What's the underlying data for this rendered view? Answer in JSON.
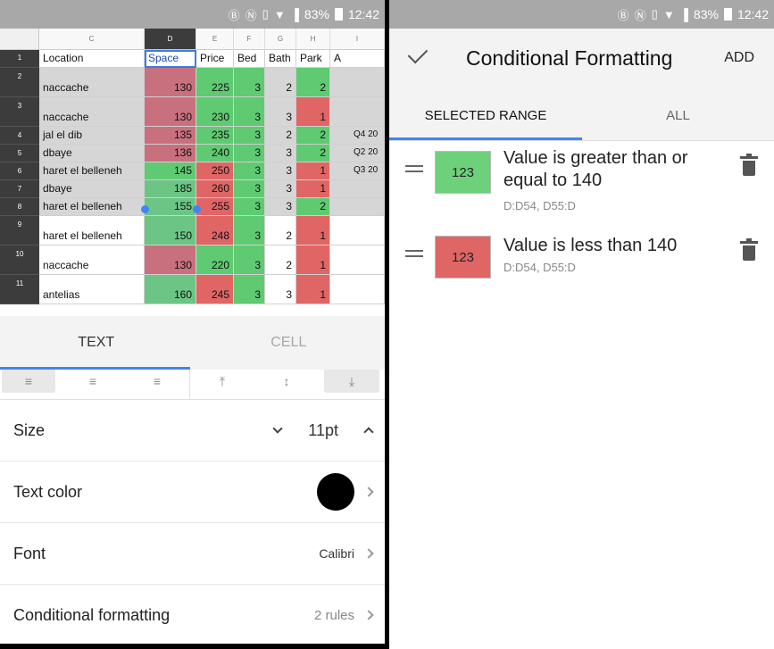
{
  "status": {
    "battery": "83%",
    "time": "12:42"
  },
  "sheet": {
    "columns": [
      "C",
      "D",
      "E",
      "F",
      "G",
      "H",
      "I"
    ],
    "header_row": {
      "num": "1",
      "cells": [
        "Location",
        "Space",
        "Price",
        "Bed",
        "Bath",
        "Park",
        "A"
      ]
    },
    "rows": [
      {
        "num": "2",
        "location": "naccache",
        "space": "130",
        "price": "225",
        "bed": "3",
        "bath": "2",
        "park": "2",
        "extra": ""
      },
      {
        "num": "3",
        "location": "naccache",
        "space": "130",
        "price": "230",
        "bed": "3",
        "bath": "3",
        "park": "1",
        "extra": ""
      },
      {
        "num": "4",
        "location": "jal el dib",
        "space": "135",
        "price": "235",
        "bed": "3",
        "bath": "2",
        "park": "2",
        "extra": "Q4 20"
      },
      {
        "num": "5",
        "location": "dbaye",
        "space": "136",
        "price": "240",
        "bed": "3",
        "bath": "3",
        "park": "2",
        "extra": "Q2 20"
      },
      {
        "num": "6",
        "location": "haret el belleneh",
        "space": "145",
        "price": "250",
        "bed": "3",
        "bath": "3",
        "park": "1",
        "extra": "Q3 20"
      },
      {
        "num": "7",
        "location": "dbaye",
        "space": "185",
        "price": "260",
        "bed": "3",
        "bath": "3",
        "park": "1",
        "extra": ""
      },
      {
        "num": "8",
        "location": "haret el belleneh",
        "space": "155",
        "price": "255",
        "bed": "3",
        "bath": "3",
        "park": "2",
        "extra": ""
      },
      {
        "num": "9",
        "location": "haret el belleneh",
        "space": "150",
        "price": "248",
        "bed": "3",
        "bath": "2",
        "park": "1",
        "extra": ""
      },
      {
        "num": "10",
        "location": "naccache",
        "space": "130",
        "price": "220",
        "bed": "3",
        "bath": "2",
        "park": "1",
        "extra": ""
      },
      {
        "num": "11",
        "location": "antelias",
        "space": "160",
        "price": "245",
        "bed": "3",
        "bath": "3",
        "park": "1",
        "extra": ""
      }
    ]
  },
  "format_panel": {
    "tab_text": "TEXT",
    "tab_cell": "CELL",
    "size_label": "Size",
    "size_value": "11pt",
    "text_color_label": "Text color",
    "text_color_value": "#000000",
    "font_label": "Font",
    "font_value": "Calibri",
    "cf_label": "Conditional formatting",
    "cf_value": "2 rules"
  },
  "cf_screen": {
    "title": "Conditional Formatting",
    "add_label": "ADD",
    "tab_selected": "SELECTED RANGE",
    "tab_all": "ALL",
    "rules": [
      {
        "sample": "123",
        "color": "#6dd07a",
        "text": "Value is greater than or equal to 140",
        "range": "D:D54, D55:D"
      },
      {
        "sample": "123",
        "color": "#e06666",
        "text": "Value is less than 140",
        "range": "D:D54, D55:D"
      }
    ]
  },
  "colors": {
    "green": "#5fca72",
    "red": "#e06666",
    "accent": "#4285f4"
  }
}
